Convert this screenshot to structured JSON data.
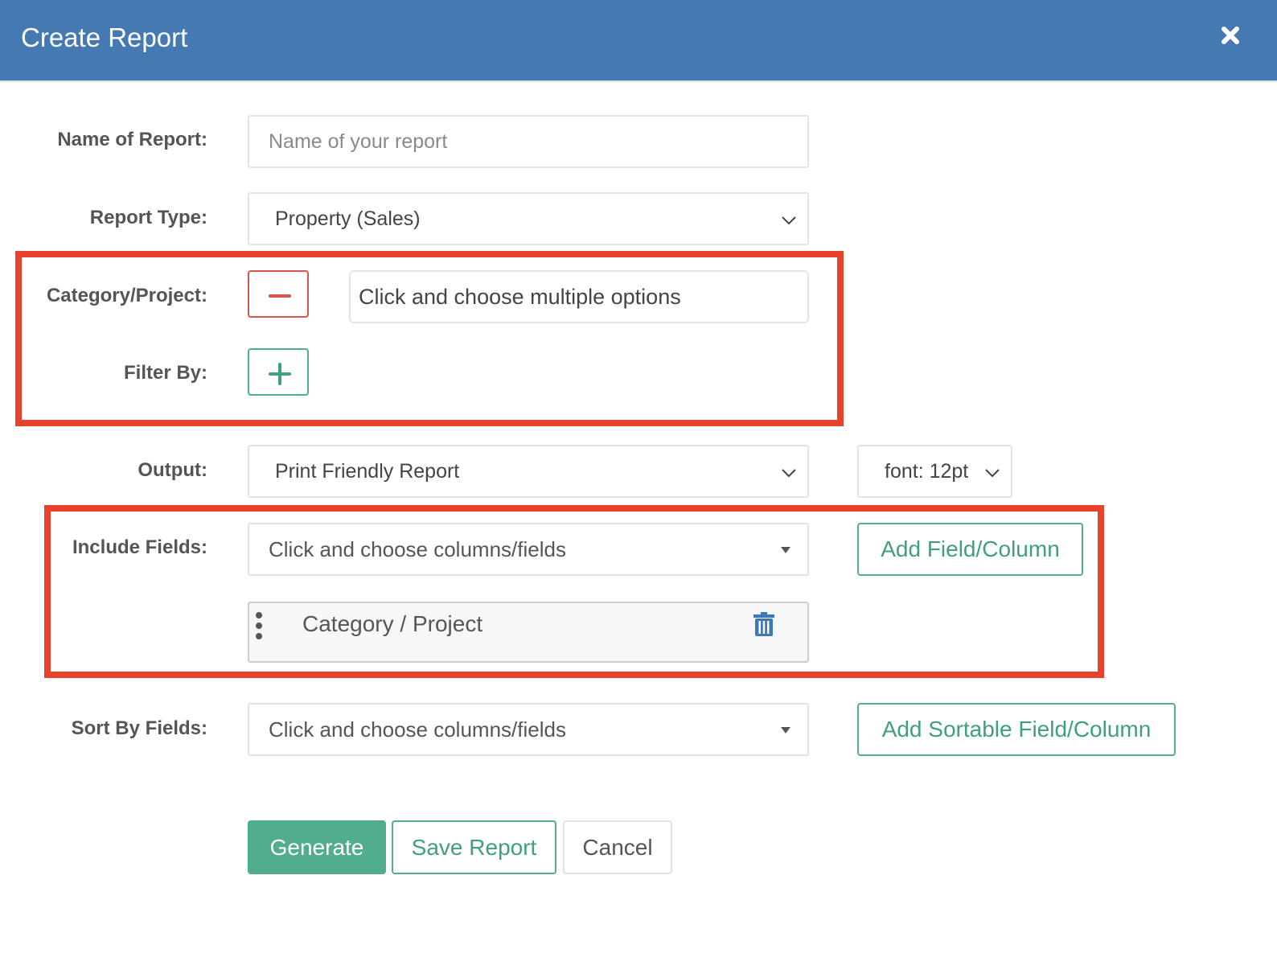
{
  "header": {
    "title": "Create Report"
  },
  "form": {
    "name_label": "Name of Report:",
    "name_placeholder": "Name of your report",
    "name_value": "",
    "type_label": "Report Type:",
    "type_value": "Property (Sales)",
    "category_label": "Category/Project:",
    "category_placeholder": "Click and choose multiple options",
    "filter_label": "Filter By:",
    "output_label": "Output:",
    "output_value": "Print Friendly Report",
    "font_value": "font: 12pt",
    "include_label": "Include Fields:",
    "include_placeholder": "Click and choose columns/fields",
    "add_field_label": "Add Field/Column",
    "included_fields": [
      {
        "label": "Category / Project"
      }
    ],
    "sort_label": "Sort By Fields:",
    "sort_placeholder": "Click and choose columns/fields",
    "add_sortable_label": "Add Sortable Field/Column"
  },
  "actions": {
    "generate_label": "Generate",
    "save_label": "Save Report",
    "cancel_label": "Cancel"
  },
  "colors": {
    "header_bg": "#447ab1",
    "primary_green": "#52ad8f",
    "danger_red": "#d9534f",
    "highlight_red": "#e8422c",
    "trash_blue": "#3d78b4"
  },
  "icons": {
    "close": "close-icon",
    "minus": "minus-icon",
    "plus": "plus-icon",
    "chevron": "chevron-down-icon",
    "caret": "caret-down-icon",
    "drag": "drag-handle-icon",
    "trash": "trash-icon"
  }
}
